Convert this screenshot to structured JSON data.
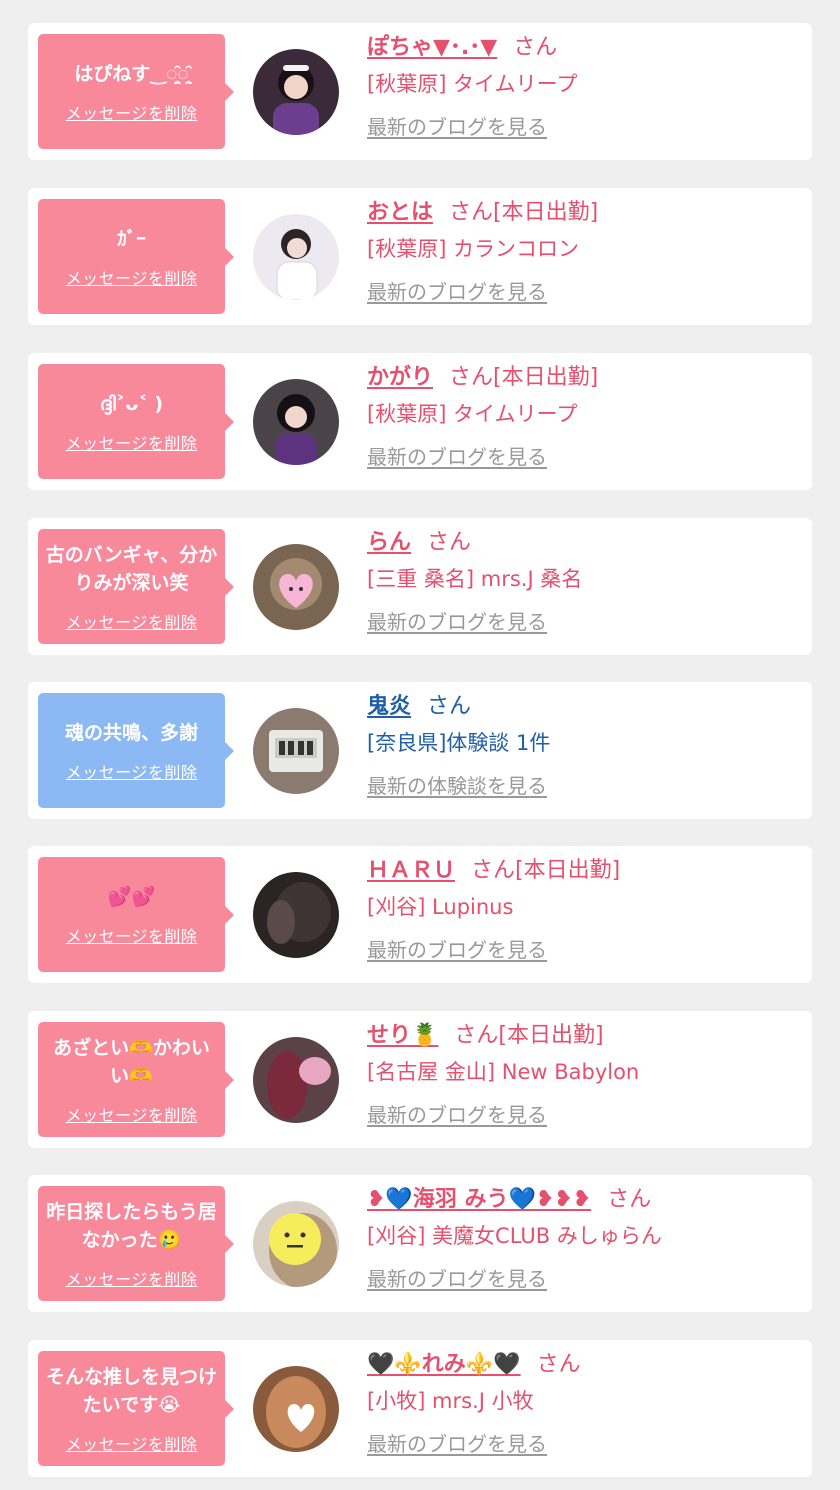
{
  "cards": [
    {
      "message": "はぴねす‿◌̤͙̑◌̤͙̑",
      "delete_label": "メッセージを削除",
      "name": "ぽちゃ▼･.･▼",
      "suffix": "さん",
      "shop": "[秋葉原] タイムリープ",
      "link": "最新のブログを見る",
      "theme": "pink",
      "avatar_icon": "girl-photo-icon"
    },
    {
      "message": "ｶﾞｰ",
      "delete_label": "メッセージを削除",
      "name": "おとは",
      "suffix": "さん[本日出勤]",
      "shop": "[秋葉原] カランコロン",
      "link": "最新のブログを見る",
      "theme": "pink",
      "avatar_icon": "girl-photo-icon"
    },
    {
      "message": "ദ്ദി˃ᴗ˂ )",
      "delete_label": "メッセージを削除",
      "name": "かがり",
      "suffix": "さん[本日出勤]",
      "shop": "[秋葉原] タイムリープ",
      "link": "最新のブログを見る",
      "theme": "pink",
      "avatar_icon": "girl-photo-icon"
    },
    {
      "message": "古のバンギャ、分かりみが深い笑",
      "delete_label": "メッセージを削除",
      "name": "らん",
      "suffix": "さん",
      "shop": "[三重 桑名] mrs.J 桑名",
      "link": "最新のブログを見る",
      "theme": "pink",
      "avatar_icon": "girl-photo-icon"
    },
    {
      "message": "魂の共鳴、多謝",
      "delete_label": "メッセージを削除",
      "name": "鬼炎",
      "suffix": "さん",
      "shop": "[奈良県]体験談 1件",
      "link": "最新の体験談を見る",
      "theme": "blue",
      "avatar_icon": "clock-photo-icon"
    },
    {
      "message": "💕💕",
      "delete_label": "メッセージを削除",
      "name": "ＨＡＲＵ",
      "suffix": "さん[本日出勤]",
      "shop": "[刈谷] Lupinus",
      "link": "最新のブログを見る",
      "theme": "pink",
      "avatar_icon": "girl-photo-icon"
    },
    {
      "message": "あざとい🫶かわいい🫶",
      "delete_label": "メッセージを削除",
      "name": "せり🍍",
      "suffix": "さん[本日出勤]",
      "shop": "[名古屋 金山] New Babylon",
      "link": "最新のブログを見る",
      "theme": "pink",
      "avatar_icon": "girl-photo-icon"
    },
    {
      "message": "昨日探したらもう居なかった🥲",
      "delete_label": "メッセージを削除",
      "name": "❥💙海羽 みう💙❥❥❥",
      "suffix": "さん",
      "shop": "[刈谷] 美魔女CLUB みしゅらん",
      "link": "最新のブログを見る",
      "theme": "pink",
      "avatar_icon": "girl-photo-icon"
    },
    {
      "message": "そんな推しを見つけたいです😭",
      "delete_label": "メッセージを削除",
      "name": "🖤⚜️れみ⚜️🖤",
      "suffix": "さん",
      "shop": "[小牧] mrs.J 小牧",
      "link": "最新のブログを見る",
      "theme": "pink",
      "avatar_icon": "girl-photo-icon"
    }
  ],
  "colors": {
    "pink_bubble": "#f7899b",
    "blue_bubble": "#8cb9f3",
    "pink_text": "#e4506d",
    "blue_text": "#1f5fa8",
    "link_gray": "#999999"
  }
}
